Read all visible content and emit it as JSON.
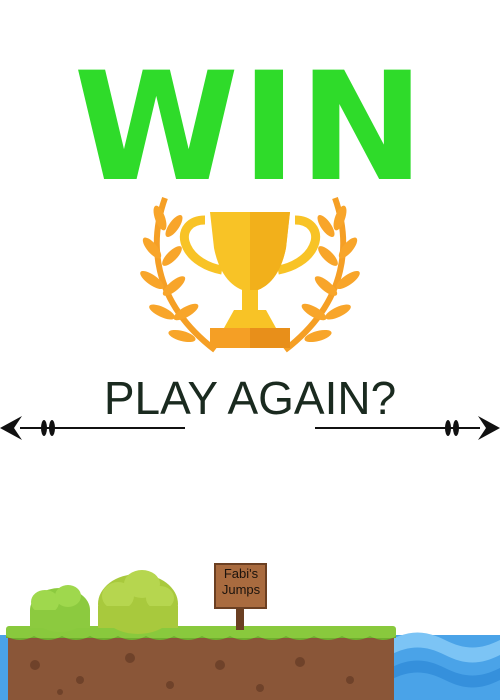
{
  "title": "WIN",
  "play_again": "PLAY AGAIN?",
  "sign": {
    "line1": "Fabi's",
    "line2": "Jumps"
  },
  "colors": {
    "title_green": "#2fdb2a",
    "trophy_gold": "#f8c326",
    "trophy_orange": "#f59f25",
    "grass": "#89c93d",
    "dirt": "#8a5638",
    "water": "#4aa3e8"
  },
  "icons": [
    "trophy-icon",
    "laurel-wreath-icon",
    "arrow-divider-left",
    "arrow-divider-right"
  ]
}
